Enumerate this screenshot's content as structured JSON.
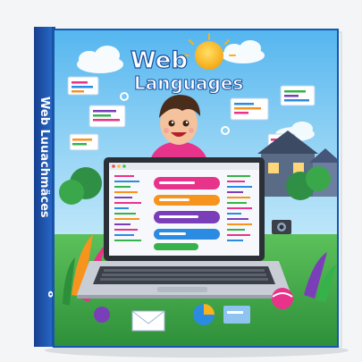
{
  "cover": {
    "title_line1": "Web",
    "title_line2": "Languages",
    "spine_title": "Web Luuachmäces",
    "spine_number": "8"
  },
  "icons": [
    "sun-icon",
    "cloud-icon",
    "gear-icon",
    "camera-icon",
    "code-window-icon",
    "envelope-icon",
    "ball-icon"
  ],
  "colors": {
    "cover_blue": "#1f6fc9",
    "spine_blue": "#1b4ea8",
    "sky": "#8ad0f4",
    "grass": "#3aa84a",
    "sun": "#f7b21d",
    "accent_pink": "#e8338a",
    "accent_orange": "#f7941d",
    "accent_purple": "#7a3fb8"
  }
}
